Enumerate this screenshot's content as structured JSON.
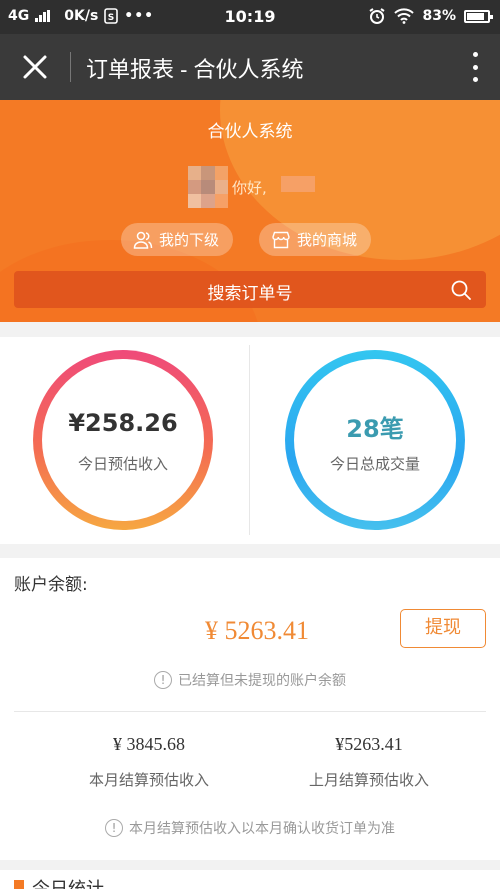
{
  "status_bar": {
    "network": "4G",
    "speed": "0K/s",
    "time": "10:19",
    "battery": "83%"
  },
  "title_bar": {
    "title": "订单报表 - 合伙人系统"
  },
  "header": {
    "system_name": "合伙人系统",
    "greeting": "你好,",
    "my_subordinates": "我的下级",
    "my_shop": "我的商城",
    "search_placeholder": "搜索订单号"
  },
  "stats": {
    "today_income_value": "¥258.26",
    "today_income_label": "今日预估收入",
    "today_orders_value": "28笔",
    "today_orders_label": "今日总成交量"
  },
  "balance": {
    "title": "账户余额:",
    "amount": "¥ 5263.41",
    "withdraw_label": "提现",
    "note": "已结算但未提现的账户余额",
    "this_month_value": "¥ 3845.68",
    "this_month_label": "本月结算预估收入",
    "last_month_value": "¥5263.41",
    "last_month_label": "上月结算预估收入",
    "month_note": "本月结算预估收入以本月确认收货订单为准"
  },
  "today_section": {
    "title": "今日统计"
  },
  "colors": {
    "accent_orange": "#f47a25",
    "income_ring_start": "#ef4a7a",
    "orders_ring": "#33c6f0"
  }
}
